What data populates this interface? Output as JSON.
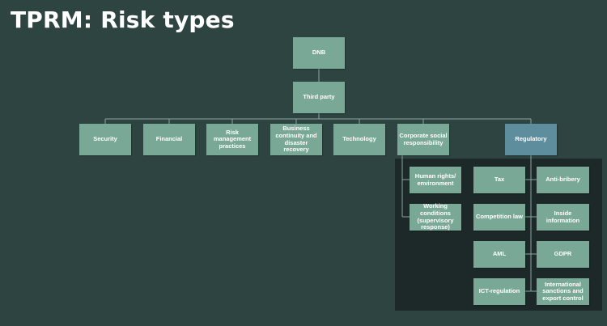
{
  "slide": {
    "title": "TPRM: Risk types"
  },
  "nodes": {
    "root": "DNB",
    "third_party": "Third party",
    "security": "Security",
    "financial": "Financial",
    "risk_management": "Risk management practices",
    "business_continuity": "Business continuity and disaster recovery",
    "technology": "Technology",
    "csr": "Corporate social responsibility",
    "regulatory": "Regulatory",
    "human_rights": "Human rights/ environment",
    "working_conditions": "Working conditions (supervisory response)",
    "tax": "Tax",
    "anti_bribery": "Anti-bribery",
    "competition_law": "Competition law",
    "inside_information": "Inside information",
    "aml": "AML",
    "gdpr": "GDPR",
    "ict_regulation": "ICT-regulation",
    "sanctions": "International sanctions and export control"
  },
  "colors": {
    "background": "#2d4441",
    "box": "#7aa897",
    "highlight": "#5e8e9e",
    "panel": "#1c2928"
  }
}
